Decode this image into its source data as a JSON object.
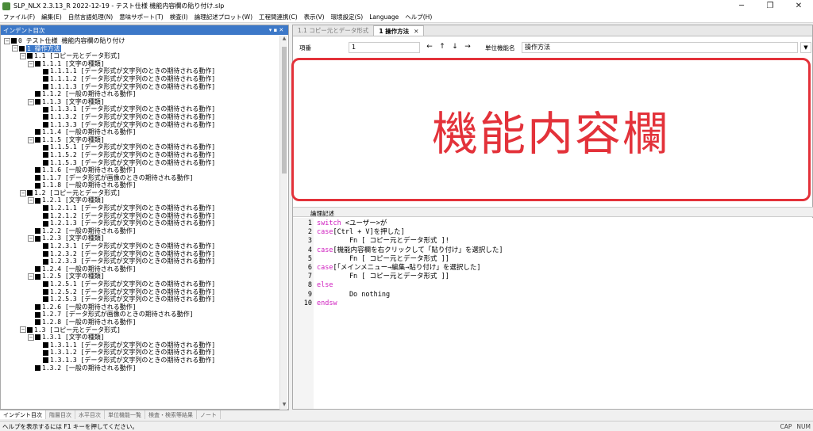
{
  "window": {
    "title": "SLP_NLX 2.3.13_R 2022-12-19 - テスト仕様 機能内容欄の貼り付け.slp",
    "min_icon": "minimize-icon",
    "max_icon": "restore-icon",
    "close_icon": "close-icon",
    "min_glyph": "─",
    "max_glyph": "❐",
    "close_glyph": "✕"
  },
  "menu": [
    "ファイル(F)",
    "編集(E)",
    "自然言語処理(N)",
    "意味サポート(T)",
    "検査(I)",
    "論理記述プロット(W)",
    "工程間連携(C)",
    "表示(V)",
    "環境設定(S)",
    "Language",
    "ヘルプ(H)"
  ],
  "left_pane": {
    "title": "インデント目次",
    "pin": "▾ ▪ ✕",
    "tree": [
      {
        "indent": 0,
        "toggle": "⊟",
        "label": "0 テスト仕様 機能内容欄の貼り付け"
      },
      {
        "indent": 1,
        "toggle": "⊟",
        "label": "1 操作方法",
        "selected": true
      },
      {
        "indent": 2,
        "toggle": "⊟",
        "label": "1.1 [コピー元とデータ形式]"
      },
      {
        "indent": 3,
        "toggle": "⊟",
        "label": "1.1.1 [文字の種類]"
      },
      {
        "indent": 4,
        "toggle": "",
        "label": "1.1.1.1 [データ形式が文字列のときの期待される動作]"
      },
      {
        "indent": 4,
        "toggle": "",
        "label": "1.1.1.2 [データ形式が文字列のときの期待される動作]"
      },
      {
        "indent": 4,
        "toggle": "",
        "label": "1.1.1.3 [データ形式が文字列のときの期待される動作]"
      },
      {
        "indent": 3,
        "toggle": "",
        "label": "1.1.2 [一般の期待される動作]"
      },
      {
        "indent": 3,
        "toggle": "⊟",
        "label": "1.1.3 [文字の種類]"
      },
      {
        "indent": 4,
        "toggle": "",
        "label": "1.1.3.1 [データ形式が文字列のときの期待される動作]"
      },
      {
        "indent": 4,
        "toggle": "",
        "label": "1.1.3.2 [データ形式が文字列のときの期待される動作]"
      },
      {
        "indent": 4,
        "toggle": "",
        "label": "1.1.3.3 [データ形式が文字列のときの期待される動作]"
      },
      {
        "indent": 3,
        "toggle": "",
        "label": "1.1.4 [一般の期待される動作]"
      },
      {
        "indent": 3,
        "toggle": "⊟",
        "label": "1.1.5 [文字の種類]"
      },
      {
        "indent": 4,
        "toggle": "",
        "label": "1.1.5.1 [データ形式が文字列のときの期待される動作]"
      },
      {
        "indent": 4,
        "toggle": "",
        "label": "1.1.5.2 [データ形式が文字列のときの期待される動作]"
      },
      {
        "indent": 4,
        "toggle": "",
        "label": "1.1.5.3 [データ形式が文字列のときの期待される動作]"
      },
      {
        "indent": 3,
        "toggle": "",
        "label": "1.1.6 [一般の期待される動作]"
      },
      {
        "indent": 3,
        "toggle": "",
        "label": "1.1.7 [データ形式が画像のときの期待される動作]"
      },
      {
        "indent": 3,
        "toggle": "",
        "label": "1.1.8 [一般の期待される動作]"
      },
      {
        "indent": 2,
        "toggle": "⊟",
        "label": "1.2 [コピー元とデータ形式]"
      },
      {
        "indent": 3,
        "toggle": "⊟",
        "label": "1.2.1 [文字の種類]"
      },
      {
        "indent": 4,
        "toggle": "",
        "label": "1.2.1.1 [データ形式が文字列のときの期待される動作]"
      },
      {
        "indent": 4,
        "toggle": "",
        "label": "1.2.1.2 [データ形式が文字列のときの期待される動作]"
      },
      {
        "indent": 4,
        "toggle": "",
        "label": "1.2.1.3 [データ形式が文字列のときの期待される動作]"
      },
      {
        "indent": 3,
        "toggle": "",
        "label": "1.2.2 [一般の期待される動作]"
      },
      {
        "indent": 3,
        "toggle": "⊟",
        "label": "1.2.3 [文字の種類]"
      },
      {
        "indent": 4,
        "toggle": "",
        "label": "1.2.3.1 [データ形式が文字列のときの期待される動作]"
      },
      {
        "indent": 4,
        "toggle": "",
        "label": "1.2.3.2 [データ形式が文字列のときの期待される動作]"
      },
      {
        "indent": 4,
        "toggle": "",
        "label": "1.2.3.3 [データ形式が文字列のときの期待される動作]"
      },
      {
        "indent": 3,
        "toggle": "",
        "label": "1.2.4 [一般の期待される動作]"
      },
      {
        "indent": 3,
        "toggle": "⊟",
        "label": "1.2.5 [文字の種類]"
      },
      {
        "indent": 4,
        "toggle": "",
        "label": "1.2.5.1 [データ形式が文字列のときの期待される動作]"
      },
      {
        "indent": 4,
        "toggle": "",
        "label": "1.2.5.2 [データ形式が文字列のときの期待される動作]"
      },
      {
        "indent": 4,
        "toggle": "",
        "label": "1.2.5.3 [データ形式が文字列のときの期待される動作]"
      },
      {
        "indent": 3,
        "toggle": "",
        "label": "1.2.6 [一般の期待される動作]"
      },
      {
        "indent": 3,
        "toggle": "",
        "label": "1.2.7 [データ形式が画像のときの期待される動作]"
      },
      {
        "indent": 3,
        "toggle": "",
        "label": "1.2.8 [一般の期待される動作]"
      },
      {
        "indent": 2,
        "toggle": "⊟",
        "label": "1.3 [コピー元とデータ形式]"
      },
      {
        "indent": 3,
        "toggle": "⊟",
        "label": "1.3.1 [文字の種類]"
      },
      {
        "indent": 4,
        "toggle": "",
        "label": "1.3.1.1 [データ形式が文字列のときの期待される動作]"
      },
      {
        "indent": 4,
        "toggle": "",
        "label": "1.3.1.2 [データ形式が文字列のときの期待される動作]"
      },
      {
        "indent": 4,
        "toggle": "",
        "label": "1.3.1.3 [データ形式が文字列のときの期待される動作]"
      },
      {
        "indent": 3,
        "toggle": "",
        "label": "1.3.2 [一般の期待される動作]"
      }
    ]
  },
  "bottom_tabs": [
    "インデント目次",
    "階層目次",
    "水平目次",
    "単位機能一覧",
    "検査・検索等結果",
    "ノート"
  ],
  "doc_tabs": [
    {
      "label": "1.1 コピー元とデータ形式",
      "active": false
    },
    {
      "label": "1 操作方法",
      "active": true,
      "close": "✕"
    }
  ],
  "fields": {
    "item_label": "項番",
    "item_value": "1",
    "nav": [
      "←",
      "↑",
      "↓",
      "→"
    ],
    "unit_label": "単位機能名",
    "unit_value": "操作方法",
    "drop": "▼"
  },
  "content_box": {
    "text": "機能内容欄",
    "accent": "#e3323a"
  },
  "code_section": {
    "label": "論理記述"
  },
  "code": [
    [
      {
        "t": "switch",
        "k": true
      },
      {
        "t": " <ユーザー>が"
      }
    ],
    [
      {
        "t": "case",
        "k": true
      },
      {
        "t": "[Ctrl + V]を押した]"
      }
    ],
    [
      {
        "t": "        Fn [ コピー元とデータ形式 ]!"
      }
    ],
    [
      {
        "t": "case",
        "k": true
      },
      {
        "t": "[機能内容欄を右クリックして「貼り付け」を選択した]"
      }
    ],
    [
      {
        "t": "        Fn [ コピー元とデータ形式 ]]"
      }
    ],
    [
      {
        "t": "case",
        "k": true
      },
      {
        "t": "[「メインメニュー→編集→貼り付け」を選択した]"
      }
    ],
    [
      {
        "t": "        Fn [ コピー元とデータ形式 ]]"
      }
    ],
    [
      {
        "t": "else",
        "k": true
      }
    ],
    [
      {
        "t": "        Do nothing"
      }
    ],
    [
      {
        "t": "endsw",
        "k": true
      }
    ]
  ],
  "status": {
    "text": "ヘルプを表示するには F1 キーを押してください。",
    "cap": "CAP",
    "num": "NUM"
  }
}
